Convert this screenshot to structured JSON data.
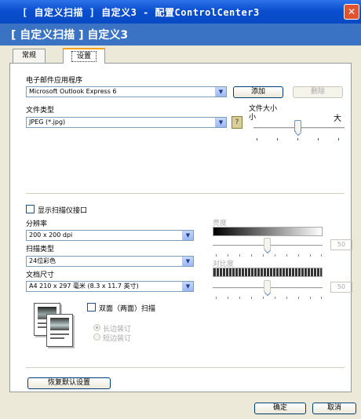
{
  "window": {
    "title": "[ 自定义扫描 ] 自定义3 - 配置ControlCenter3",
    "close_glyph": "✕"
  },
  "header": {
    "title": "[ 自定义扫描 ] 自定义3"
  },
  "tabs": [
    {
      "label": "常规",
      "active": false
    },
    {
      "label": "设置",
      "active": true
    }
  ],
  "email": {
    "label": "电子邮件应用程序",
    "value": "Microsoft Outlook Express 6",
    "add_label": "添加",
    "delete_label": "删除"
  },
  "file_type": {
    "label": "文件类型",
    "value": "JPEG (*.jpg)"
  },
  "file_size": {
    "label": "文件大小",
    "small": "小",
    "large": "大",
    "level": 0.5
  },
  "scanner_interface": {
    "label": "显示扫描仪接口",
    "checked": false
  },
  "resolution": {
    "label": "分辨率",
    "value": "200 x 200 dpi"
  },
  "scan_type": {
    "label": "扫描类型",
    "value": "24位彩色"
  },
  "doc_size": {
    "label": "文档尺寸",
    "value": "A4 210 x 297 毫米 (8.3 x 11.7 英寸)"
  },
  "brightness": {
    "label": "亮度",
    "value": "50"
  },
  "contrast": {
    "label": "对比度",
    "value": "50"
  },
  "duplex": {
    "label": "双面（两面）扫描",
    "checked": false,
    "long_edge": "长边装订",
    "short_edge": "短边装订"
  },
  "restore_label": "恢复默认设置",
  "ok_label": "确定",
  "cancel_label": "取消",
  "icons": {
    "combo_arrow": "▼",
    "help": "?"
  }
}
